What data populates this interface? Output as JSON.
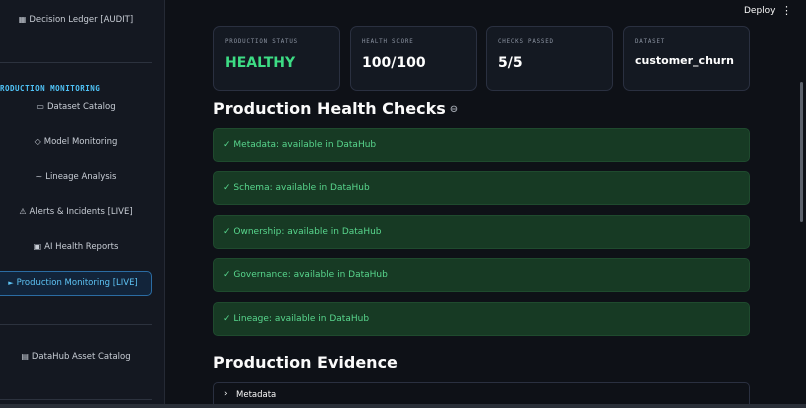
{
  "sidebar": {
    "top_item": {
      "icon": "ledger-icon",
      "glyph": "▦",
      "label": "Decision Ledger [AUDIT]"
    },
    "section_title": "RODUCTION MONITORING",
    "items": [
      {
        "icon": "folder-icon",
        "glyph": "▭",
        "label": "Dataset Catalog"
      },
      {
        "icon": "diamond-icon",
        "glyph": "◇",
        "label": "Model Monitoring"
      },
      {
        "icon": "wave-icon",
        "glyph": "~",
        "label": "Lineage Analysis"
      },
      {
        "icon": "warning-icon",
        "glyph": "⚠",
        "label": "Alerts & Incidents [LIVE]"
      },
      {
        "icon": "report-icon",
        "glyph": "▣",
        "label": "AI Health Reports"
      }
    ],
    "active_item": {
      "icon": "play-icon",
      "glyph": "►",
      "label": "Production Monitoring [LIVE]"
    },
    "bottom_item": {
      "icon": "catalog-icon",
      "glyph": "▤",
      "label": "DataHub Asset Catalog"
    }
  },
  "header": {
    "deploy_label": "Deploy",
    "menu_glyph": "⋮"
  },
  "metrics": [
    {
      "label": "PRODUCTION STATUS",
      "value": "HEALTHY"
    },
    {
      "label": "HEALTH SCORE",
      "value": "100/100"
    },
    {
      "label": "CHECKS PASSED",
      "value": "5/5"
    },
    {
      "label": "DATASET",
      "value": "customer_churn"
    }
  ],
  "health_checks": {
    "title": "Production Health Checks",
    "link_glyph": "⊖",
    "items": [
      "✓ Metadata: available in DataHub",
      "✓ Schema: available in DataHub",
      "✓ Ownership: available in DataHub",
      "✓ Governance: available in DataHub",
      "✓ Lineage: available in DataHub"
    ]
  },
  "evidence": {
    "title": "Production Evidence",
    "expander_chevron": "›",
    "expander_label": "Metadata"
  },
  "colors": {
    "accent": "#4fc3f7",
    "success_text": "#58d68d",
    "success_bg": "#173a24",
    "healthy": "#3ddc84",
    "background": "#0e1117"
  }
}
